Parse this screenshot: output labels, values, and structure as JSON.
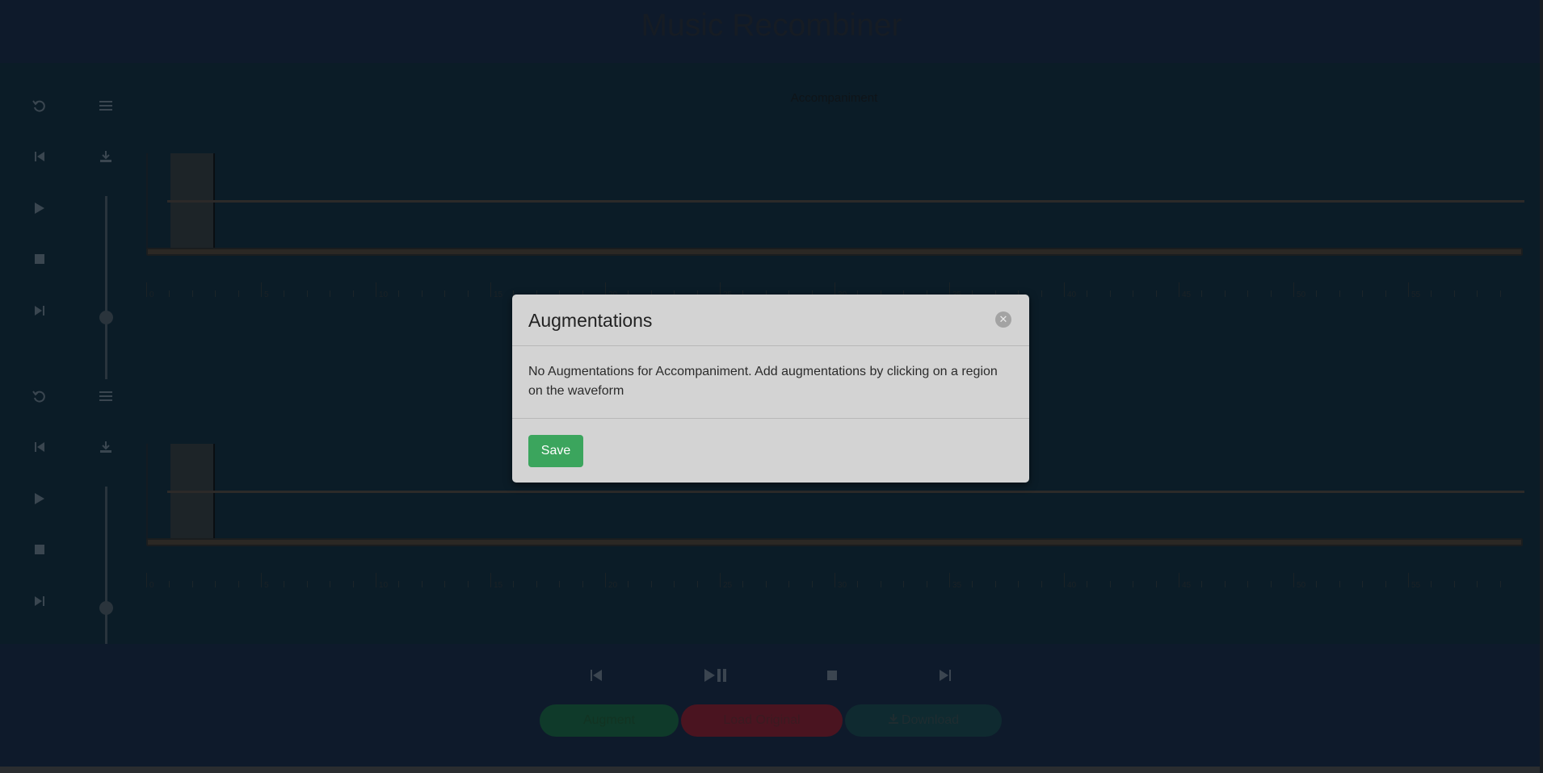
{
  "app": {
    "title": "Music Recombiner"
  },
  "tracks": [
    {
      "label": "Accompaniment"
    },
    {
      "label": ""
    }
  ],
  "track_controls": {
    "undo_icon": "undo-icon",
    "menu_icon": "menu-icon",
    "skip_back_icon": "skip-back-icon",
    "download_icon": "download-icon",
    "play_icon": "play-icon",
    "stop_icon": "stop-icon",
    "skip_forward_icon": "skip-forward-icon"
  },
  "timeline": {
    "labels": [
      "0",
      "5",
      "10",
      "15",
      "20",
      "25",
      "30",
      "35",
      "40",
      "45",
      "50",
      "55"
    ]
  },
  "transport": {
    "icons": [
      "skip-back-icon",
      "play-pause-icon",
      "stop-icon",
      "skip-forward-icon"
    ]
  },
  "actions": {
    "augment_label": "Augment",
    "load_original_label": "Load Original",
    "download_label": "Download"
  },
  "colors": {
    "augment": "#0f3a2a",
    "load_original": "#4a1420",
    "download": "#0f2a30",
    "save": "#3ba55d"
  },
  "modal": {
    "title": "Augmentations",
    "body": "No Augmentations for Accompaniment. Add augmentations by clicking on a region on the waveform",
    "save_label": "Save"
  }
}
